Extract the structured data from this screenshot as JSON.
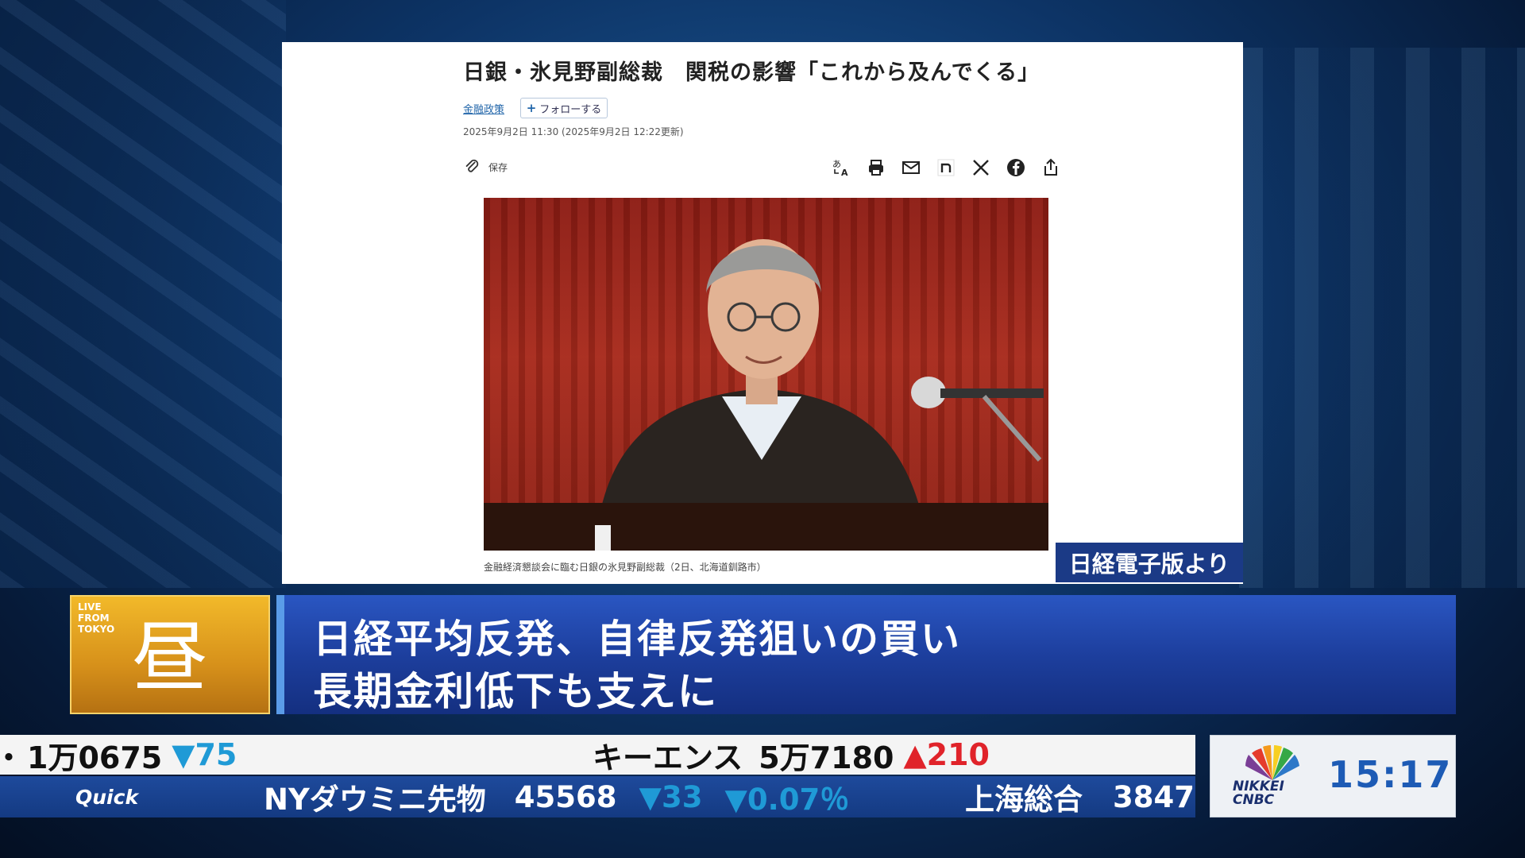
{
  "article": {
    "title": "日銀・氷見野副総裁　関税の影響「これから及んでくる」",
    "category": "金融政策",
    "follow_label": "フォローする",
    "date": "2025年9月2日 11:30 (2025年9月2日 12:22更新)",
    "save_label": "保存",
    "caption": "金融経済懇談会に臨む日銀の氷見野副総裁（2日、北海道釧路市）",
    "share_icons": [
      "translate-icon",
      "print-icon",
      "mail-icon",
      "note-icon",
      "x-icon",
      "facebook-icon",
      "share-icon"
    ]
  },
  "source_badge": "日経電子版より",
  "live": {
    "label_line1": "LIVE",
    "label_line2": "FROM",
    "label_line3": "TOKYO",
    "kanji": "昼"
  },
  "headline": {
    "line1": "日経平均反発、自律反発狙いの買い",
    "line2": "長期金利低下も支えに"
  },
  "ticker_top": {
    "left_value": "1万0675",
    "left_change": "▼75",
    "name": "キーエンス",
    "value": "5万7180",
    "change": "▲210"
  },
  "ticker_bottom": {
    "brand": "Quick",
    "item1_name": "NYダウミニ先物",
    "item1_value": "45568",
    "item1_change": "▼33",
    "item1_pct": "▼0.07％",
    "item2_name": "上海総合",
    "item2_value": "3847."
  },
  "network": {
    "logo_text_1": "NIKKEI",
    "logo_text_2": "CNBC",
    "time": "15:17"
  },
  "colors": {
    "headline_blue": "#1d3f9e",
    "live_gold": "#d6901a",
    "down": "#1f9ad6",
    "up": "#e0232a",
    "clock": "#1d5bb5"
  }
}
